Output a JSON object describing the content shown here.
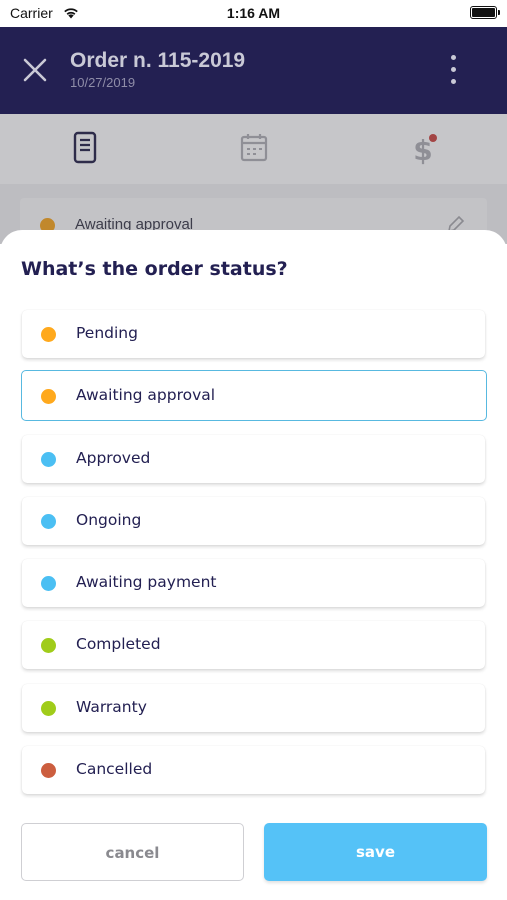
{
  "status_bar": {
    "carrier": "Carrier",
    "time": "1:16 AM"
  },
  "header": {
    "title": "Order n. 115-2019",
    "date": "10/27/2019"
  },
  "background_card": {
    "label": "Awaiting approval",
    "dot_color": "#c1882c"
  },
  "sheet": {
    "title": "What’s the order status?",
    "selected": "Awaiting approval",
    "options": [
      {
        "label": "Pending",
        "color": "#ffa91d"
      },
      {
        "label": "Awaiting approval",
        "color": "#ffa91d"
      },
      {
        "label": "Approved",
        "color": "#4bbff3"
      },
      {
        "label": "Ongoing",
        "color": "#4bbff3"
      },
      {
        "label": "Awaiting payment",
        "color": "#4bbff3"
      },
      {
        "label": "Completed",
        "color": "#a0cc1a"
      },
      {
        "label": "Warranty",
        "color": "#a0cc1a"
      },
      {
        "label": "Cancelled",
        "color": "#cc5e3f"
      }
    ]
  },
  "actions": {
    "cancel_label": "cancel",
    "save_label": "save"
  }
}
